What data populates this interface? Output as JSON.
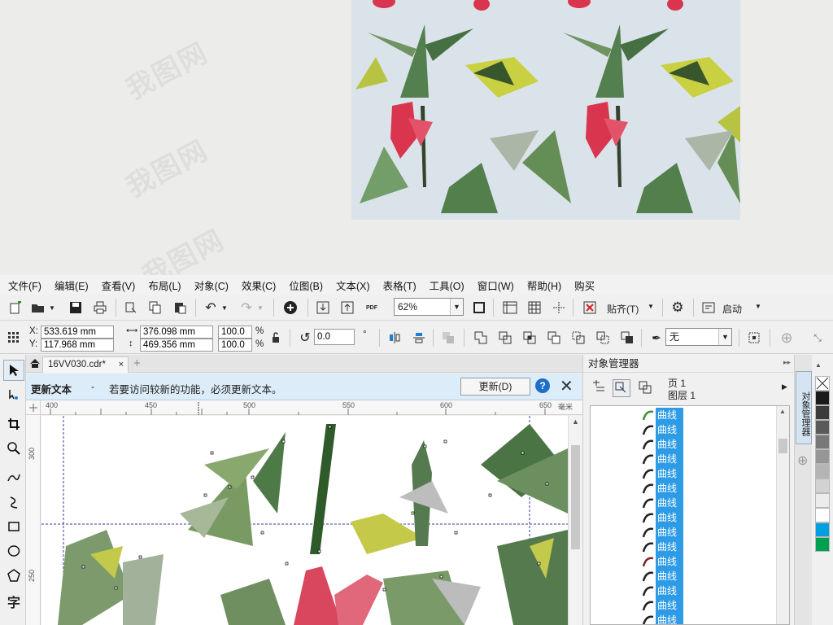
{
  "menu": [
    "文件(F)",
    "编辑(E)",
    "查看(V)",
    "布局(L)",
    "对象(C)",
    "效果(C)",
    "位图(B)",
    "文本(X)",
    "表格(T)",
    "工具(O)",
    "窗口(W)",
    "帮助(H)",
    "购买"
  ],
  "toolbar": {
    "zoom": "62%",
    "snap_label": "贴齐(T)",
    "launch_label": "启动",
    "pdf_label": "PDF"
  },
  "property_bar": {
    "x_label": "X:",
    "x_value": "533.619 mm",
    "y_label": "Y:",
    "y_value": "117.968 mm",
    "width_value": "376.098 mm",
    "height_value": "469.356 mm",
    "scale_w": "100.0",
    "scale_h": "100.0",
    "percent": "%",
    "rotation": "0.0",
    "degree": "°",
    "outline": "无"
  },
  "document": {
    "tab_name": "16VV030.cdr*",
    "info_title": "更新文本",
    "info_dash": "-",
    "info_message": "若要访问较新的功能，必须更新文本。",
    "info_button": "更新(D)"
  },
  "ruler": {
    "top_ticks": [
      "400",
      "450",
      "500",
      "550",
      "600",
      "650"
    ],
    "top_unit": "毫米",
    "left_ticks": [
      "300",
      "250"
    ]
  },
  "object_manager": {
    "title": "对象管理器",
    "page_label": "页 1",
    "layer_label": "图层 1",
    "items": [
      "曲线",
      "曲线",
      "曲线",
      "曲线",
      "曲线",
      "曲线",
      "曲线",
      "曲线",
      "曲线",
      "曲线",
      "曲线",
      "曲线",
      "曲线",
      "曲线",
      "曲线"
    ],
    "dock_tab": "对象管理器"
  },
  "palette_colors": [
    "#ffffff",
    "#1a1a1a",
    "#3b3b3b",
    "#5a5a5a",
    "#787878",
    "#969696",
    "#b4b4b4",
    "#d2d2d2",
    "#ececec",
    "#ffffff",
    "#00a0e0",
    "#00a050"
  ],
  "watermark": "我图网"
}
